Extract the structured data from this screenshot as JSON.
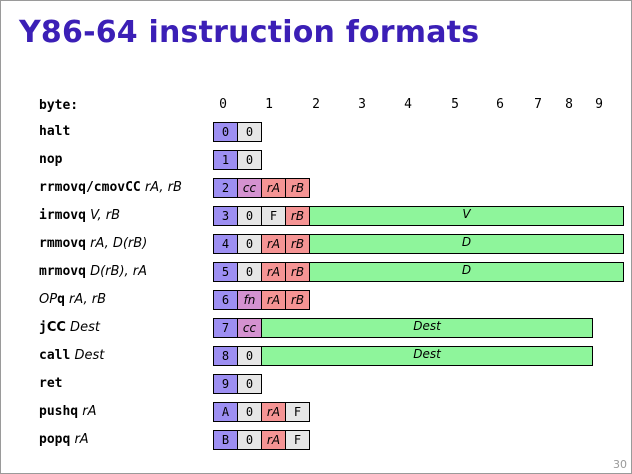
{
  "title": "Y86-64 instruction formats",
  "byte_header": {
    "label": "byte:",
    "numbers": [
      "0",
      "1",
      "2",
      "3",
      "4",
      "5",
      "6",
      "7",
      "8",
      "9"
    ]
  },
  "instructions": [
    {
      "parts": [
        {
          "t": "halt",
          "s": "mono"
        }
      ],
      "cells": [
        {
          "text": "0",
          "kind": "icode"
        },
        {
          "text": "0",
          "kind": "ifun0"
        }
      ]
    },
    {
      "parts": [
        {
          "t": "nop",
          "s": "mono"
        }
      ],
      "cells": [
        {
          "text": "1",
          "kind": "icode"
        },
        {
          "text": "0",
          "kind": "ifun0"
        }
      ]
    },
    {
      "parts": [
        {
          "t": "rrmovq/cmovCC",
          "s": "mono"
        },
        {
          "t": " rA, rB",
          "s": "ital"
        }
      ],
      "cells": [
        {
          "text": "2",
          "kind": "icode"
        },
        {
          "text": "cc",
          "kind": "ifun"
        },
        {
          "text": "rA",
          "kind": "reg"
        },
        {
          "text": "rB",
          "kind": "reg"
        }
      ]
    },
    {
      "parts": [
        {
          "t": "irmovq",
          "s": "mono"
        },
        {
          "t": " V, rB",
          "s": "ital"
        }
      ],
      "cells": [
        {
          "text": "3",
          "kind": "icode"
        },
        {
          "text": "0",
          "kind": "ifun0"
        },
        {
          "text": "F",
          "kind": "regF"
        },
        {
          "text": "rB",
          "kind": "reg"
        }
      ],
      "wide": {
        "text": "V",
        "end": 10
      }
    },
    {
      "parts": [
        {
          "t": "rmmovq",
          "s": "mono"
        },
        {
          "t": " rA, D(rB)",
          "s": "ital"
        }
      ],
      "cells": [
        {
          "text": "4",
          "kind": "icode"
        },
        {
          "text": "0",
          "kind": "ifun0"
        },
        {
          "text": "rA",
          "kind": "reg"
        },
        {
          "text": "rB",
          "kind": "reg"
        }
      ],
      "wide": {
        "text": "D",
        "end": 10
      }
    },
    {
      "parts": [
        {
          "t": "mrmovq",
          "s": "mono"
        },
        {
          "t": " D(rB), rA",
          "s": "ital"
        }
      ],
      "cells": [
        {
          "text": "5",
          "kind": "icode"
        },
        {
          "text": "0",
          "kind": "ifun0"
        },
        {
          "text": "rA",
          "kind": "reg"
        },
        {
          "text": "rB",
          "kind": "reg"
        }
      ],
      "wide": {
        "text": "D",
        "end": 10
      }
    },
    {
      "parts": [
        {
          "t": "OP",
          "s": "ital"
        },
        {
          "t": "q",
          "s": "mono"
        },
        {
          "t": " rA, rB",
          "s": "ital"
        }
      ],
      "cells": [
        {
          "text": "6",
          "kind": "icode"
        },
        {
          "text": "fn",
          "kind": "ifun"
        },
        {
          "text": "rA",
          "kind": "reg"
        },
        {
          "text": "rB",
          "kind": "reg"
        }
      ]
    },
    {
      "parts": [
        {
          "t": "j",
          "s": "mono"
        },
        {
          "t": "CC",
          "s": "plain"
        },
        {
          "t": " Dest",
          "s": "ital"
        }
      ],
      "cells": [
        {
          "text": "7",
          "kind": "icode"
        },
        {
          "text": "cc",
          "kind": "ifun"
        }
      ],
      "wide": {
        "text": "Dest",
        "end": 9
      }
    },
    {
      "parts": [
        {
          "t": "call",
          "s": "mono"
        },
        {
          "t": " Dest",
          "s": "ital"
        }
      ],
      "cells": [
        {
          "text": "8",
          "kind": "icode"
        },
        {
          "text": "0",
          "kind": "ifun0"
        }
      ],
      "wide": {
        "text": "Dest",
        "end": 9
      }
    },
    {
      "parts": [
        {
          "t": "ret",
          "s": "mono"
        }
      ],
      "cells": [
        {
          "text": "9",
          "kind": "icode"
        },
        {
          "text": "0",
          "kind": "ifun0"
        }
      ]
    },
    {
      "parts": [
        {
          "t": "pushq",
          "s": "mono"
        },
        {
          "t": " rA",
          "s": "ital"
        }
      ],
      "cells": [
        {
          "text": "A",
          "kind": "icode"
        },
        {
          "text": "0",
          "kind": "ifun0"
        },
        {
          "text": "rA",
          "kind": "reg"
        },
        {
          "text": "F",
          "kind": "regF"
        }
      ]
    },
    {
      "parts": [
        {
          "t": "popq",
          "s": "mono"
        },
        {
          "t": " rA",
          "s": "ital"
        }
      ],
      "cells": [
        {
          "text": "B",
          "kind": "icode"
        },
        {
          "text": "0",
          "kind": "ifun0"
        },
        {
          "text": "rA",
          "kind": "reg"
        },
        {
          "text": "F",
          "kind": "regF"
        }
      ]
    }
  ],
  "page_number": "30",
  "colors": {
    "title": "#3b1fb6",
    "icode": "#9d8ff2",
    "ifun": "#d492d0",
    "register": "#f59494",
    "constant": "#8ef59b",
    "zero_nibble": "#e6e6e6"
  }
}
